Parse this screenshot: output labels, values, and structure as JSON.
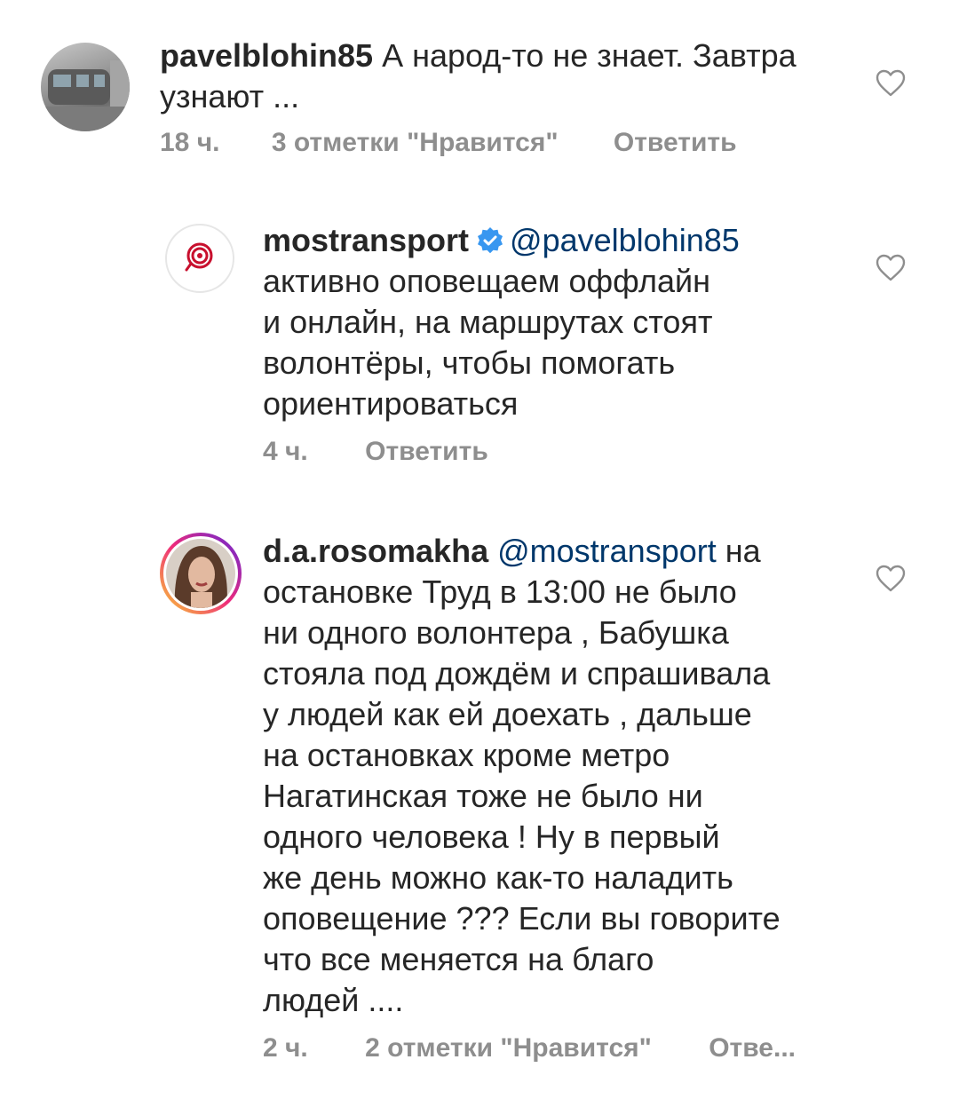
{
  "comments": [
    {
      "username": "pavelblohin85",
      "lines": [
        "А народ-то не знает. Завтра",
        "узнают ..."
      ],
      "time": "18 ч.",
      "likes": "3 отметки \"Нравится\"",
      "reply": "Ответить"
    },
    {
      "username": "mostransport",
      "verified": true,
      "mention": "@pavelblohin85",
      "lines": [
        "активно оповещаем оффлайн",
        "и онлайн, на маршрутах стоят",
        "волонтёры, чтобы помогать",
        "ориентироваться"
      ],
      "time": "4 ч.",
      "reply": "Ответить"
    },
    {
      "username": "d.a.rosomakha",
      "mention": "@mostransport",
      "first_line_rest": "на",
      "lines": [
        "остановке Труд в 13:00 не было",
        "ни одного волонтера , Бабушка",
        "стояла под дождём и спрашивала",
        "у людей как ей доехать , дальше",
        "на остановках кроме метро",
        "Нагатинская тоже не было ни",
        "одного человека ! Ну в первый",
        "же день можно как-то наладить",
        "оповещение ??? Если вы говорите",
        "что все меняется на благо",
        "людей ...."
      ],
      "time": "2 ч.",
      "likes": "2 отметки \"Нравится\"",
      "reply": "Отве..."
    }
  ],
  "colors": {
    "text": "#262626",
    "meta": "#8e8e8e",
    "mention": "#00376b",
    "verified": "#3897f0",
    "mostransport_logo": "#c8102e"
  },
  "icons": [
    "heart-icon",
    "verified-badge-icon",
    "mostransport-logo-icon"
  ]
}
